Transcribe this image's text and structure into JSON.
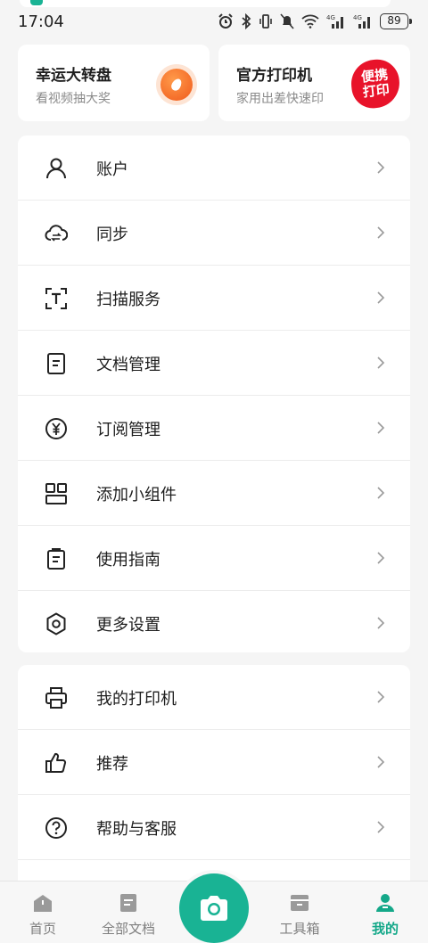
{
  "status_bar": {
    "time": "17:04",
    "battery": "89"
  },
  "promos": [
    {
      "title": "幸运大转盘",
      "subtitle": "看视频抽大奖",
      "icon": "lucky-wheel-icon"
    },
    {
      "title": "官方打印机",
      "subtitle": "家用出差快速印",
      "badge_line1": "便携",
      "badge_line2": "打印"
    }
  ],
  "menu_group_1": [
    {
      "label": "账户",
      "icon": "user-icon"
    },
    {
      "label": "同步",
      "icon": "cloud-sync-icon"
    },
    {
      "label": "扫描服务",
      "icon": "scan-text-icon"
    },
    {
      "label": "文档管理",
      "icon": "document-icon"
    },
    {
      "label": "订阅管理",
      "icon": "yen-icon"
    },
    {
      "label": "添加小组件",
      "icon": "widget-icon"
    },
    {
      "label": "使用指南",
      "icon": "guide-icon"
    },
    {
      "label": "更多设置",
      "icon": "gear-icon"
    }
  ],
  "menu_group_2": [
    {
      "label": "我的打印机",
      "icon": "printer-icon"
    },
    {
      "label": "推荐",
      "icon": "thumbs-up-icon"
    },
    {
      "label": "帮助与客服",
      "icon": "help-icon"
    }
  ],
  "tabs": [
    {
      "label": "首页",
      "icon": "home-icon",
      "active": false
    },
    {
      "label": "全部文档",
      "icon": "all-docs-icon",
      "active": false
    },
    {
      "label": "工具箱",
      "icon": "toolbox-icon",
      "active": false
    },
    {
      "label": "我的",
      "icon": "profile-icon",
      "active": true
    }
  ],
  "colors": {
    "accent": "#19b394",
    "active_tab": "#14a889",
    "badge_red": "#e8132a"
  }
}
